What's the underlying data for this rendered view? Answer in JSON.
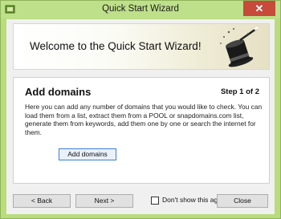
{
  "window": {
    "title": "Quick Start Wizard",
    "close_glyph": "✕"
  },
  "banner": {
    "welcome_text": "Welcome to the Quick Start Wizard!"
  },
  "content": {
    "heading": "Add domains",
    "step": "Step 1 of 2",
    "description": "Here you can add any number of domains that you would like to check. You can load them from a list, extract them from a POOL or snapdomains.com list, generate them from keywords,  add them one by one or search the internet for them.",
    "add_button_label": "Add domains"
  },
  "footer": {
    "back_label": "< Back",
    "next_label": "Next >",
    "dont_show_label": "Don't show this again",
    "dont_show_checked": false,
    "close_label": "Close"
  },
  "colors": {
    "titlebar": "#bfe08a",
    "close_button": "#c74a3a",
    "focus_border": "#3c7fd6"
  }
}
